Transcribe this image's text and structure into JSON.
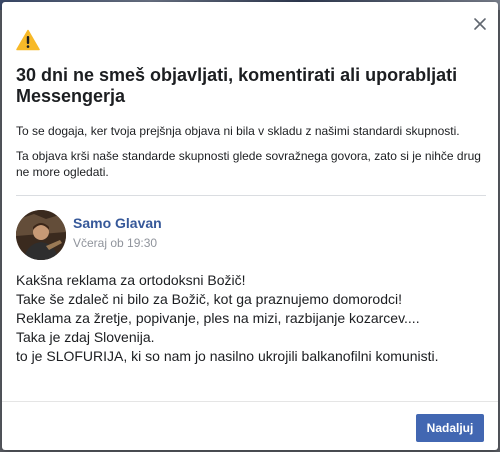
{
  "dialog": {
    "title": "30 dni ne smeš objavljati, komentirati ali uporabljati Messengerja",
    "paragraph_1": "To se dogaja, ker tvoja prejšnja objava ni bila v skladu z našimi standardi skupnosti.",
    "paragraph_2": "Ta objava krši naše standarde skupnosti glede sovražnega govora, zato si je nihče drug ne more ogledati.",
    "warning_icon": "warning-triangle-icon",
    "close_icon": "close-icon",
    "continue_label": "Nadaljuj"
  },
  "post": {
    "author": "Samo Glavan",
    "timestamp": "Včeraj ob 19:30",
    "lines": [
      "Kakšna reklama za ortodoksni Božič!",
      "Take še zdaleč ni bilo za Božič, kot ga praznujemo domorodci!",
      "Reklama za žretje, popivanje, ples na mizi, razbijanje kozarcev....",
      "Taka je zdaj Slovenija.",
      "to je SLOFURIJA, ki so nam jo nasilno ukrojili balkanofilni komunisti."
    ]
  },
  "colors": {
    "author_link": "#365899",
    "button_bg": "#4267b2",
    "warning": "#f7b928",
    "timestamp": "#90949c"
  }
}
